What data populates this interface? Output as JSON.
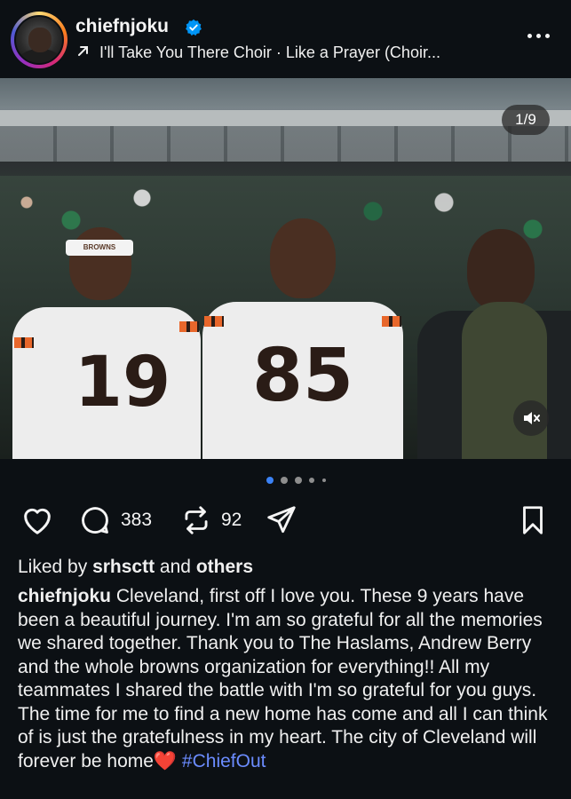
{
  "post_header": {
    "username": "chiefnjoku",
    "audio_line": "I'll Take You There Choir · Like a Prayer (Choir..."
  },
  "icons": {
    "verified": "verified-badge-icon",
    "audio": "arrow-up-right-icon",
    "more": "more-options-icon",
    "like": "heart-outline-icon",
    "comment": "comment-icon",
    "repost": "repost-icon",
    "share": "send-icon",
    "save": "bookmark-icon",
    "mute": "speaker-muted-icon"
  },
  "media": {
    "counter": "1/9",
    "total_slides": 9,
    "current_slide": 1,
    "jersey_left": "19",
    "jersey_center": "85",
    "headband_text": "BROWNS"
  },
  "actions": {
    "comments_count": "383",
    "reposts_count": "92"
  },
  "likes": {
    "prefix": "Liked by ",
    "user": "srhsctt",
    "middle": " and ",
    "others": "others"
  },
  "caption": {
    "username": "chiefnjoku",
    "text": "Cleveland, first off I love you. These 9 years have been a beautiful journey. I'm am so grateful for all the memories we shared together. Thank you to The Haslams, Andrew Berry and the whole browns organization for everything!! All my teammates I shared the battle with I'm so grateful for you guys. The time for me to find a new home has come and all I can think of is just the gratefulness in my heart. The city of Cleveland will forever be home",
    "emoji": "❤️",
    "hashtag": "#ChiefOut"
  },
  "colors": {
    "background": "#0c1014",
    "verified_blue": "#0095f6",
    "hashtag_blue": "#6b8cff",
    "active_dot": "#3b82f6",
    "browns_orange": "#e8672b"
  }
}
